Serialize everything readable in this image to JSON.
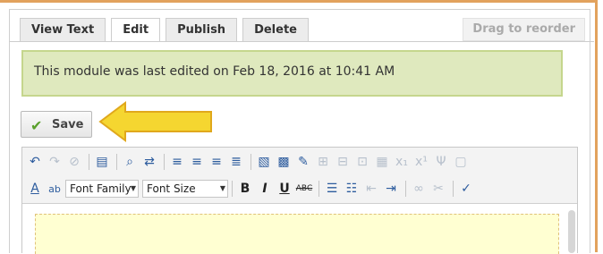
{
  "tabs": [
    {
      "label": "View Text"
    },
    {
      "label": "Edit"
    },
    {
      "label": "Publish"
    },
    {
      "label": "Delete"
    }
  ],
  "drag_label": "Drag to reorder",
  "notice": "This module was last edited on Feb 18, 2016 at 10:41 AM",
  "save_label": "Save",
  "toolbar": {
    "font_family": "Font Family",
    "font_size": "Font Size"
  },
  "colors": {
    "accent_orange": "#e2a25d",
    "notice_bg": "#dfe9be",
    "arrow_yellow": "#f5d630",
    "editor_bg": "#ffffd2"
  }
}
